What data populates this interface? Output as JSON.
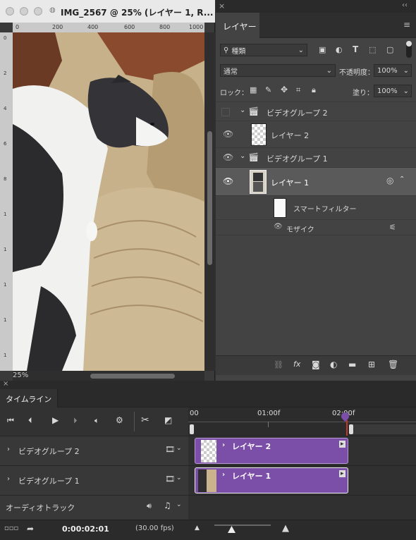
{
  "document": {
    "title": "IMG_2567 @ 25% (レイヤー 1, R...",
    "zoom": "25%",
    "ruler_top": [
      "0",
      "200",
      "400",
      "600",
      "800",
      "1000"
    ],
    "ruler_left": [
      "0",
      "2",
      "4",
      "6",
      "8",
      "1",
      "1",
      "1",
      "1",
      "1",
      "2"
    ]
  },
  "layers_panel": {
    "tab": "レイヤー",
    "filter_kind": "種類",
    "blend_mode": "通常",
    "opacity_label": "不透明度：",
    "opacity_value": "100%",
    "lock_label": "ロック：",
    "fill_label": "塗り：",
    "fill_value": "100%",
    "layers": [
      {
        "name": "ビデオグループ 2",
        "type": "group",
        "visible": false
      },
      {
        "name": "レイヤー 2",
        "type": "layer",
        "visible": true
      },
      {
        "name": "ビデオグループ 1",
        "type": "group",
        "visible": true
      },
      {
        "name": "レイヤー 1",
        "type": "layer",
        "visible": true,
        "selected": true
      }
    ],
    "smart_filter_label": "スマートフィルター",
    "filter_name": "モザイク",
    "bottom_icons": [
      "link-icon",
      "fx-icon",
      "mask-icon",
      "adjustment-icon",
      "folder-icon",
      "new-layer-icon",
      "trash-icon"
    ]
  },
  "timeline": {
    "tab": "タイムライン",
    "ruler_labels": [
      "00",
      "01:00f",
      "02:00f"
    ],
    "tracks": [
      {
        "name": "ビデオグループ 2",
        "clip": "レイヤー 2"
      },
      {
        "name": "ビデオグループ 1",
        "clip": "レイヤー 1"
      },
      {
        "name": "オーディオトラック",
        "clip": ""
      }
    ],
    "timecode": "0:00:02:01",
    "fps": "(30.00 fps)"
  },
  "colors": {
    "clip_purple": "#7b4ea8",
    "playhead": "#c0392b",
    "panel_bg": "#434343"
  }
}
